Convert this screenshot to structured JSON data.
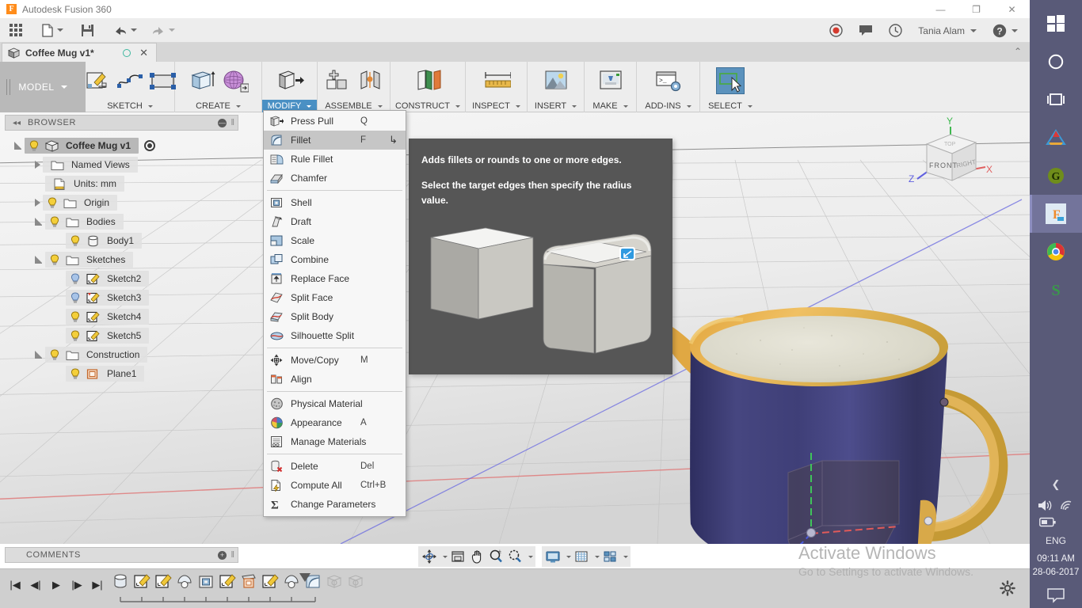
{
  "window": {
    "app_title": "Autodesk Fusion 360",
    "logo_letter": "F",
    "minimize": "—",
    "restore": "❐",
    "close": "✕"
  },
  "quick_access": {
    "apps_grid": "app-grid-icon",
    "file": "file-icon",
    "save": "save-icon",
    "undo": "undo-icon",
    "redo": "redo-icon",
    "record": "record-icon",
    "comments": "comments-icon",
    "history": "history-icon",
    "username": "Tania Alam",
    "help": "?"
  },
  "document_tab": {
    "name": "Coffee Mug v1*",
    "close": "✕",
    "collapse": "⌃"
  },
  "ribbon": {
    "workspace": "MODEL",
    "groups": [
      {
        "label": "SKETCH",
        "active": false
      },
      {
        "label": "CREATE",
        "active": false
      },
      {
        "label": "MODIFY",
        "active": true
      },
      {
        "label": "ASSEMBLE",
        "active": false
      },
      {
        "label": "CONSTRUCT",
        "active": false
      },
      {
        "label": "INSPECT",
        "active": false
      },
      {
        "label": "INSERT",
        "active": false
      },
      {
        "label": "MAKE",
        "active": false
      },
      {
        "label": "ADD-INS",
        "active": false
      },
      {
        "label": "SELECT",
        "active": false
      }
    ]
  },
  "modify_menu": {
    "items": [
      {
        "label": "Press Pull",
        "key": "Q",
        "icon": "press-pull-icon",
        "sep_after": false,
        "highlight": false,
        "hook": ""
      },
      {
        "label": "Fillet",
        "key": "F",
        "icon": "fillet-icon",
        "sep_after": false,
        "highlight": true,
        "hook": "↳"
      },
      {
        "label": "Rule Fillet",
        "key": "",
        "icon": "rule-fillet-icon",
        "sep_after": false,
        "highlight": false,
        "hook": ""
      },
      {
        "label": "Chamfer",
        "key": "",
        "icon": "chamfer-icon",
        "sep_after": true,
        "highlight": false,
        "hook": ""
      },
      {
        "label": "Shell",
        "key": "",
        "icon": "shell-icon",
        "sep_after": false,
        "highlight": false,
        "hook": ""
      },
      {
        "label": "Draft",
        "key": "",
        "icon": "draft-icon",
        "sep_after": false,
        "highlight": false,
        "hook": ""
      },
      {
        "label": "Scale",
        "key": "",
        "icon": "scale-icon",
        "sep_after": false,
        "highlight": false,
        "hook": ""
      },
      {
        "label": "Combine",
        "key": "",
        "icon": "combine-icon",
        "sep_after": false,
        "highlight": false,
        "hook": ""
      },
      {
        "label": "Replace Face",
        "key": "",
        "icon": "replace-face-icon",
        "sep_after": false,
        "highlight": false,
        "hook": ""
      },
      {
        "label": "Split Face",
        "key": "",
        "icon": "split-face-icon",
        "sep_after": false,
        "highlight": false,
        "hook": ""
      },
      {
        "label": "Split Body",
        "key": "",
        "icon": "split-body-icon",
        "sep_after": false,
        "highlight": false,
        "hook": ""
      },
      {
        "label": "Silhouette Split",
        "key": "",
        "icon": "silhouette-split-icon",
        "sep_after": true,
        "highlight": false,
        "hook": ""
      },
      {
        "label": "Move/Copy",
        "key": "M",
        "icon": "move-copy-icon",
        "sep_after": false,
        "highlight": false,
        "hook": ""
      },
      {
        "label": "Align",
        "key": "",
        "icon": "align-icon",
        "sep_after": true,
        "highlight": false,
        "hook": ""
      },
      {
        "label": "Physical Material",
        "key": "",
        "icon": "physical-material-icon",
        "sep_after": false,
        "highlight": false,
        "hook": ""
      },
      {
        "label": "Appearance",
        "key": "A",
        "icon": "appearance-icon",
        "sep_after": false,
        "highlight": false,
        "hook": ""
      },
      {
        "label": "Manage Materials",
        "key": "",
        "icon": "manage-materials-icon",
        "sep_after": true,
        "highlight": false,
        "hook": ""
      },
      {
        "label": "Delete",
        "key": "Del",
        "icon": "delete-icon",
        "sep_after": false,
        "highlight": false,
        "hook": ""
      },
      {
        "label": "Compute All",
        "key": "Ctrl+B",
        "icon": "compute-all-icon",
        "sep_after": false,
        "highlight": false,
        "hook": ""
      },
      {
        "label": "Change Parameters",
        "key": "",
        "icon": "change-parameters-icon",
        "sep_after": false,
        "highlight": false,
        "hook": ""
      }
    ]
  },
  "tooltip": {
    "title": "Adds fillets or rounds to one or more edges.",
    "body": "Select the target edges then specify the radius value."
  },
  "browser": {
    "header": "BROWSER",
    "collapse": "◂◂",
    "minus": "—",
    "tree": [
      {
        "label": "Coffee Mug v1",
        "depth": 0,
        "tri": "open",
        "bulb": true,
        "bulb_color": "yellow",
        "icon": "body-cube-icon",
        "root": true,
        "radio": true
      },
      {
        "label": "Named Views",
        "depth": 1,
        "tri": "closed",
        "bulb": false,
        "bulb_color": "",
        "icon": "folder-icon",
        "root": false,
        "radio": false
      },
      {
        "label": "Units: mm",
        "depth": 1,
        "tri": "none",
        "bulb": false,
        "bulb_color": "",
        "icon": "units-icon",
        "root": false,
        "radio": false
      },
      {
        "label": "Origin",
        "depth": 1,
        "tri": "closed",
        "bulb": true,
        "bulb_color": "yellow",
        "icon": "folder-icon",
        "root": false,
        "radio": false
      },
      {
        "label": "Bodies",
        "depth": 1,
        "tri": "open",
        "bulb": true,
        "bulb_color": "yellow",
        "icon": "folder-icon",
        "root": false,
        "radio": false
      },
      {
        "label": "Body1",
        "depth": 2,
        "tri": "none",
        "bulb": true,
        "bulb_color": "yellow",
        "icon": "cylinder-icon",
        "root": false,
        "radio": false
      },
      {
        "label": "Sketches",
        "depth": 1,
        "tri": "open",
        "bulb": true,
        "bulb_color": "yellow",
        "icon": "folder-icon",
        "root": false,
        "radio": false
      },
      {
        "label": "Sketch2",
        "depth": 2,
        "tri": "none",
        "bulb": true,
        "bulb_color": "blue",
        "icon": "sketch-icon",
        "root": false,
        "radio": false
      },
      {
        "label": "Sketch3",
        "depth": 2,
        "tri": "none",
        "bulb": true,
        "bulb_color": "blue",
        "icon": "sketch-warn-icon",
        "root": false,
        "radio": false
      },
      {
        "label": "Sketch4",
        "depth": 2,
        "tri": "none",
        "bulb": true,
        "bulb_color": "yellow",
        "icon": "sketch-icon",
        "root": false,
        "radio": false
      },
      {
        "label": "Sketch5",
        "depth": 2,
        "tri": "none",
        "bulb": true,
        "bulb_color": "yellow",
        "icon": "sketch-icon",
        "root": false,
        "radio": false
      },
      {
        "label": "Construction",
        "depth": 1,
        "tri": "open",
        "bulb": true,
        "bulb_color": "yellow",
        "icon": "folder-icon",
        "root": false,
        "radio": false
      },
      {
        "label": "Plane1",
        "depth": 2,
        "tri": "none",
        "bulb": true,
        "bulb_color": "yellow",
        "icon": "plane-icon",
        "root": false,
        "radio": false
      }
    ]
  },
  "viewcube": {
    "front_face": "FRONT",
    "right_face": "RIGHT",
    "top_face": "TOP",
    "axis_x": "X",
    "axis_y": "Y",
    "axis_z": "Z"
  },
  "comments_bar": {
    "label": "COMMENTS",
    "add": "+"
  },
  "navigation_bar": {
    "buttons": [
      {
        "name": "orbit-icon",
        "caret": true
      },
      {
        "name": "look-at-icon",
        "caret": false
      },
      {
        "name": "pan-hand-icon",
        "caret": false
      },
      {
        "name": "zoom-icon",
        "caret": false
      },
      {
        "name": "zoom-window-icon",
        "caret": true
      }
    ],
    "display_buttons": [
      {
        "name": "display-settings-icon",
        "caret": true
      },
      {
        "name": "grid-snaps-icon",
        "caret": true
      },
      {
        "name": "viewports-icon",
        "caret": true
      }
    ]
  },
  "timeline": {
    "nav": [
      {
        "name": "go-to-beginning-icon",
        "glyph": "|◀"
      },
      {
        "name": "step-back-icon",
        "glyph": "◀|"
      },
      {
        "name": "play-icon",
        "glyph": "▶"
      },
      {
        "name": "step-forward-icon",
        "glyph": "|▶"
      },
      {
        "name": "go-to-end-icon",
        "glyph": "▶|"
      }
    ],
    "features": [
      {
        "name": "cylinder-feature",
        "type": "cylinder"
      },
      {
        "name": "sketch-feature-1",
        "type": "sketch"
      },
      {
        "name": "sketch-feature-2",
        "type": "sketch"
      },
      {
        "name": "revolve-feature-1",
        "type": "revolve"
      },
      {
        "name": "shell-feature",
        "type": "shell"
      },
      {
        "name": "sketch-feature-3",
        "type": "sketch"
      },
      {
        "name": "plane-feature",
        "type": "plane"
      },
      {
        "name": "sketch-feature-4",
        "type": "sketch"
      },
      {
        "name": "revolve-feature-2",
        "type": "revolve"
      },
      {
        "name": "fillet-feature",
        "type": "fillet"
      },
      {
        "name": "ghost-feature-1",
        "type": "ghost"
      },
      {
        "name": "ghost-feature-2",
        "type": "ghost"
      }
    ],
    "settings": "timeline-settings-icon"
  },
  "watermark": {
    "line1": "Activate Windows",
    "line2": "Go to Settings to activate Windows."
  },
  "taskbar": {
    "items": [
      {
        "name": "windows-start-icon"
      },
      {
        "name": "cortana-search-icon"
      },
      {
        "name": "task-view-icon"
      },
      {
        "name": "autodesk-icon"
      },
      {
        "name": "grammarly-icon"
      },
      {
        "name": "fusion360-icon"
      },
      {
        "name": "chrome-icon"
      },
      {
        "name": "skype-icon"
      }
    ],
    "tray": {
      "chevron": "❮",
      "volume": "volume-icon",
      "wifi": "wifi-icon",
      "battery": "battery-icon",
      "language": "ENG",
      "time": "09:11 AM",
      "date": "28-06-2017",
      "action_center": "action-center-icon"
    }
  },
  "colors": {
    "accent_blue": "#4a90c4",
    "taskbar": "#595a78",
    "mug_body": "#3a3a78",
    "mug_rim": "#d9a03a",
    "tooltip_bg": "#565656",
    "ribbon_bg": "#ededed"
  }
}
